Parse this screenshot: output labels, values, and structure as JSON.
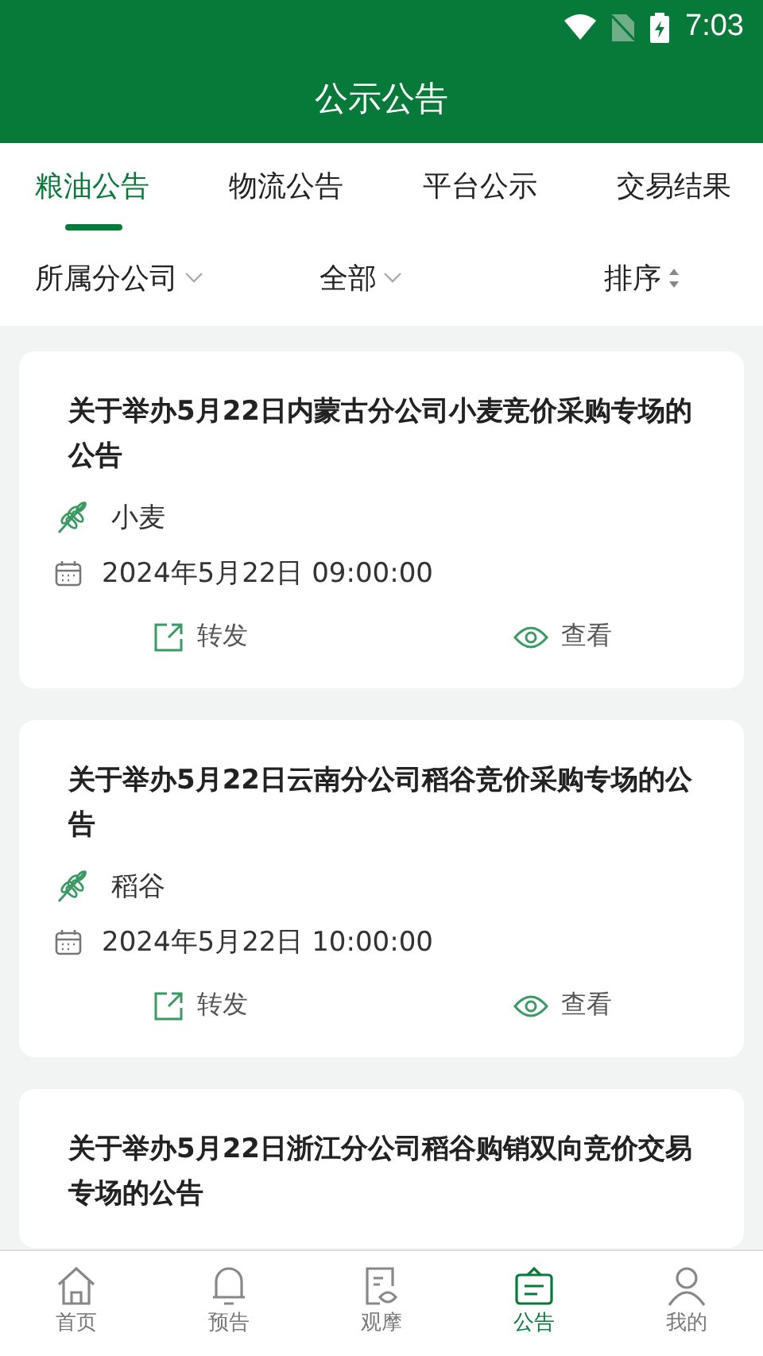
{
  "status_bar": {
    "time": "7:03"
  },
  "header": {
    "title": "公示公告"
  },
  "tabs": [
    {
      "label": "粮油公告",
      "selected": true
    },
    {
      "label": "物流公告",
      "selected": false
    },
    {
      "label": "平台公示",
      "selected": false
    },
    {
      "label": "交易结果",
      "selected": false
    }
  ],
  "filters": [
    {
      "label": "所属分公司",
      "kind": "dropdown"
    },
    {
      "label": "全部",
      "kind": "dropdown"
    },
    {
      "label": "排序",
      "kind": "sort"
    }
  ],
  "notices": [
    {
      "title": "关于举办5月22日内蒙古分公司小麦竞价采购专场的公告",
      "crop": "小麦",
      "time": "2024年5月22日 09:00:00",
      "actions": [
        "转发",
        "查看"
      ]
    },
    {
      "title": "关于举办5月22日云南分公司稻谷竞价采购专场的公告",
      "crop": "稻谷",
      "time": "2024年5月22日 10:00:00",
      "actions": [
        "转发",
        "查看"
      ]
    },
    {
      "title": "关于举办5月22日浙江分公司稻谷购销双向竞价交易专场的公告"
    }
  ],
  "bottom_nav": [
    {
      "label": "首页",
      "kind": "home",
      "selected": false
    },
    {
      "label": "预告",
      "kind": "bell",
      "selected": false
    },
    {
      "label": "观摩",
      "kind": "doc",
      "selected": false
    },
    {
      "label": "公告",
      "kind": "board",
      "selected": true
    },
    {
      "label": "我的",
      "kind": "user",
      "selected": false
    }
  ]
}
